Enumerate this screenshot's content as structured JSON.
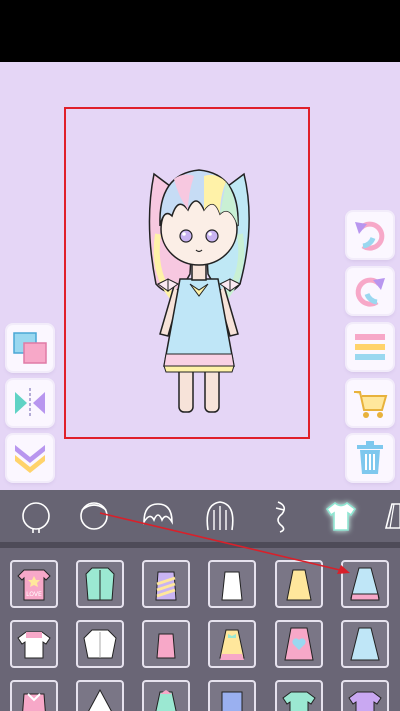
{
  "colors": {
    "stage_bg": "#e5d6f6",
    "selection_outline": "#e0202a",
    "category_bar": "#676473",
    "item_panel": "#6a6676",
    "annotation_arrow": "#d9202a"
  },
  "toolbar_left": [
    {
      "name": "layer-order-icon"
    },
    {
      "name": "flip-horizontal-icon"
    },
    {
      "name": "collapse-chevron-icon"
    }
  ],
  "toolbar_right": [
    {
      "name": "undo-icon"
    },
    {
      "name": "redo-icon"
    },
    {
      "name": "menu-icon"
    },
    {
      "name": "shopping-cart-icon"
    },
    {
      "name": "trash-icon"
    }
  ],
  "categories": [
    {
      "name": "face-icon",
      "active": false
    },
    {
      "name": "head-icon",
      "active": false
    },
    {
      "name": "bangs-icon",
      "active": false
    },
    {
      "name": "hair-icon",
      "active": false
    },
    {
      "name": "ponytail-icon",
      "active": false
    },
    {
      "name": "top-icon",
      "active": true
    },
    {
      "name": "bottom-icon",
      "active": false
    }
  ],
  "items": [
    {
      "name": "pink-love-shirt",
      "text": "LOVE"
    },
    {
      "name": "mint-coat",
      "text": ""
    },
    {
      "name": "rainbow-cami",
      "text": ""
    },
    {
      "name": "white-cami",
      "text": ""
    },
    {
      "name": "yellow-cami-dress",
      "text": ""
    },
    {
      "name": "blue-tiered-dress",
      "text": ""
    },
    {
      "name": "pink-tshirt",
      "text": ""
    },
    {
      "name": "white-shirt",
      "text": ""
    },
    {
      "name": "pink-tank",
      "text": ""
    },
    {
      "name": "yellow-bow-dress",
      "text": ""
    },
    {
      "name": "pink-heart-dress",
      "text": ""
    },
    {
      "name": "blue-long-dress",
      "text": ""
    },
    {
      "name": "pink-bow-top",
      "text": ""
    },
    {
      "name": "white-cape",
      "text": ""
    },
    {
      "name": "mint-bow-dress",
      "text": ""
    },
    {
      "name": "blue-overalls",
      "text": ""
    },
    {
      "name": "mint-tshirt",
      "text": ""
    },
    {
      "name": "purple-tshirt",
      "text": ""
    }
  ]
}
